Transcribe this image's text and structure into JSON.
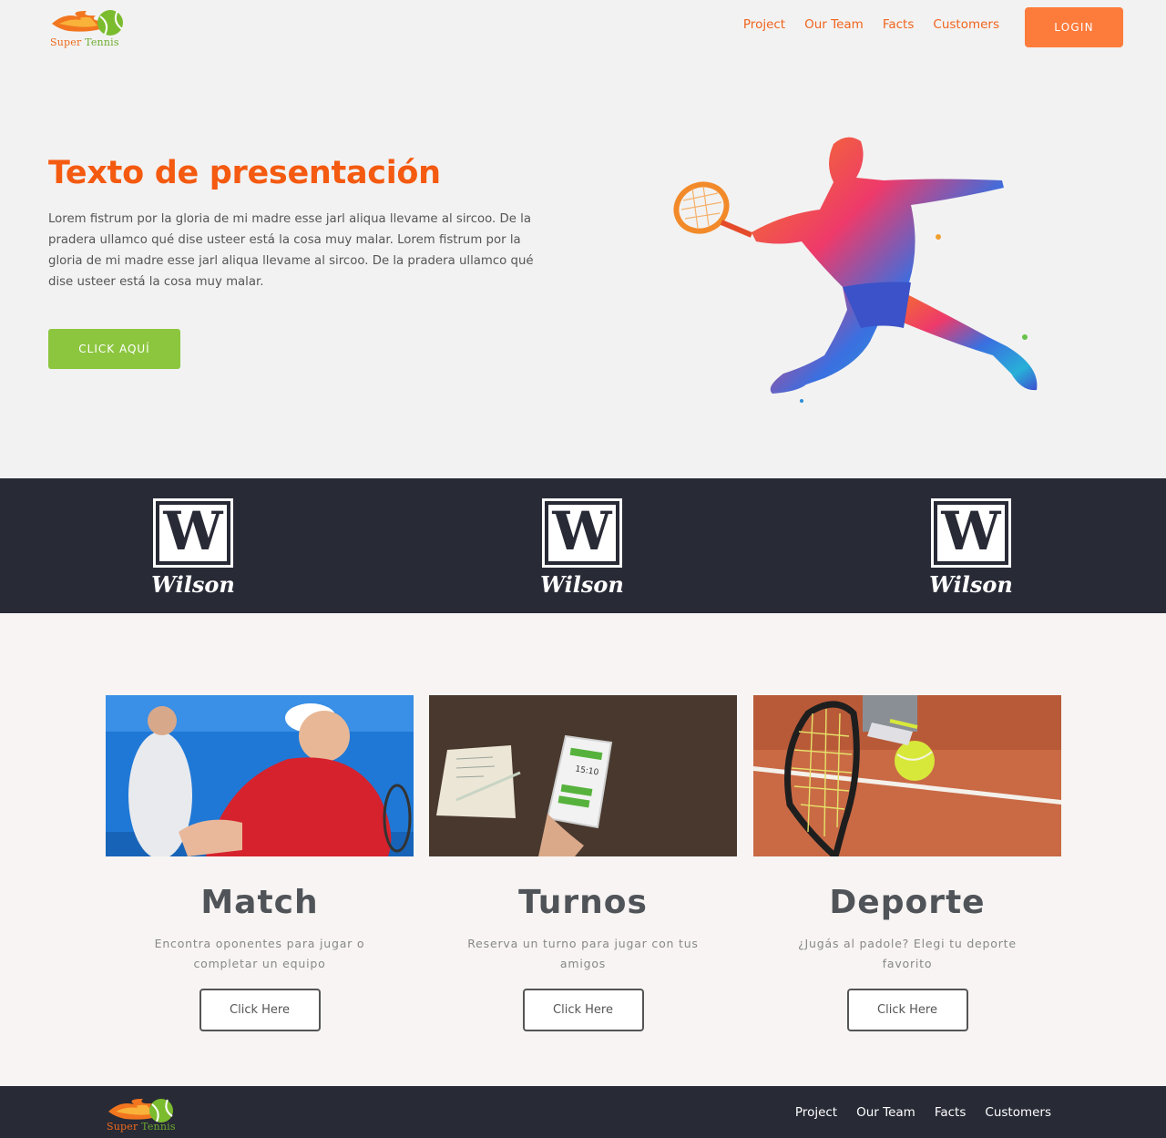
{
  "brand": {
    "logo_word1": "Super",
    "logo_word2": "Tennis"
  },
  "nav": [
    "Project",
    "Our Team",
    "Facts",
    "Customers"
  ],
  "login_label": "LOGIN",
  "hero": {
    "title": "Texto de presentación",
    "text": "Lorem fistrum por la gloria de mi madre esse jarl aliqua llevame al sircoo. De la pradera ullamco qué dise usteer está la cosa muy malar. Lorem fistrum por la gloria de mi madre esse jarl aliqua llevame al sircoo. De la pradera ullamco qué dise usteer está la cosa muy malar.",
    "button": "CLICK AQUÍ"
  },
  "brands": [
    {
      "mark": "W",
      "name": "Wilson"
    },
    {
      "mark": "W",
      "name": "Wilson"
    },
    {
      "mark": "W",
      "name": "Wilson"
    }
  ],
  "cards": [
    {
      "title": "Match",
      "desc": "Encontra oponentes para jugar o completar un equipo",
      "button": "Click Here"
    },
    {
      "title": "Turnos",
      "desc": "Reserva un turno para jugar con tus amigos",
      "button": "Click Here"
    },
    {
      "title": "Deporte",
      "desc": "¿Jugás al padole? Elegi tu deporte favorito",
      "button": "Click Here"
    }
  ],
  "footer_nav": [
    "Project",
    "Our Team",
    "Facts",
    "Customers"
  ],
  "phone_time": "15:10",
  "colors": {
    "accent": "#f45a10",
    "login": "#fd7b3b",
    "cta": "#8cc63f",
    "dark": "#282a36"
  }
}
